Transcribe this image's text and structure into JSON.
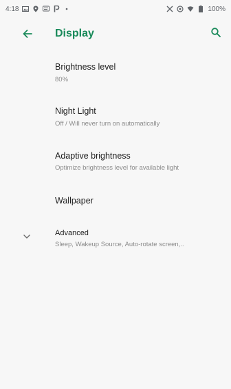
{
  "status_bar": {
    "time": "4:18",
    "battery": "100%",
    "left_icons": [
      "image-icon",
      "location-icon",
      "message-icon",
      "parking-icon",
      "dot-icon"
    ],
    "right_icons": [
      "mute-icon",
      "data-icon",
      "wifi-icon",
      "battery-icon"
    ]
  },
  "app_bar": {
    "title": "Display",
    "back_icon": "arrow-back-icon",
    "search_icon": "search-icon",
    "accent": "#1a8a5a"
  },
  "settings": {
    "brightness": {
      "title": "Brightness level",
      "summary": "80%"
    },
    "night_light": {
      "title": "Night Light",
      "summary": "Off / Will never turn on automatically"
    },
    "adaptive": {
      "title": "Adaptive brightness",
      "summary": "Optimize brightness level for available light"
    },
    "wallpaper": {
      "title": "Wallpaper"
    },
    "advanced": {
      "title": "Advanced",
      "summary": "Sleep, Wakeup Source, Auto-rotate screen,..",
      "icon": "chevron-down-icon"
    }
  }
}
